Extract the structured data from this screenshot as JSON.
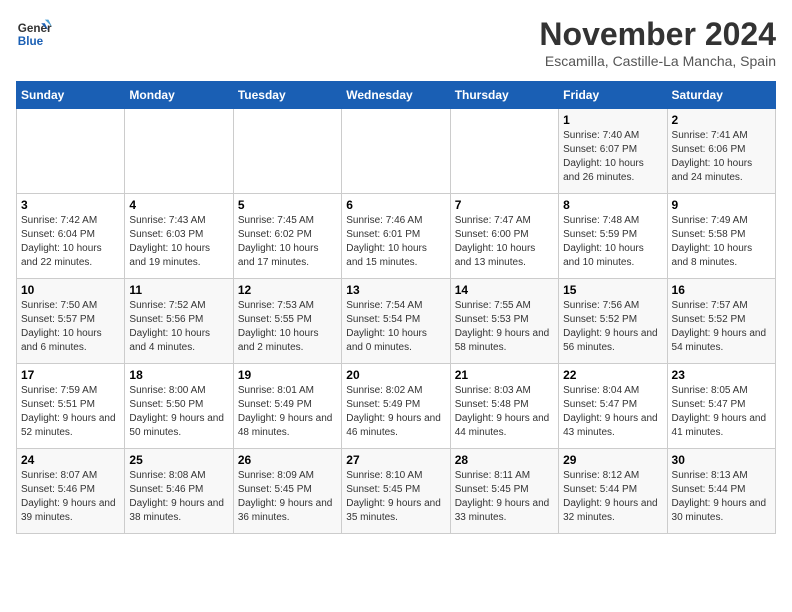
{
  "logo": {
    "line1": "General",
    "line2": "Blue"
  },
  "title": "November 2024",
  "location": "Escamilla, Castille-La Mancha, Spain",
  "days_of_week": [
    "Sunday",
    "Monday",
    "Tuesday",
    "Wednesday",
    "Thursday",
    "Friday",
    "Saturday"
  ],
  "weeks": [
    [
      {
        "day": "",
        "info": ""
      },
      {
        "day": "",
        "info": ""
      },
      {
        "day": "",
        "info": ""
      },
      {
        "day": "",
        "info": ""
      },
      {
        "day": "",
        "info": ""
      },
      {
        "day": "1",
        "info": "Sunrise: 7:40 AM\nSunset: 6:07 PM\nDaylight: 10 hours and 26 minutes."
      },
      {
        "day": "2",
        "info": "Sunrise: 7:41 AM\nSunset: 6:06 PM\nDaylight: 10 hours and 24 minutes."
      }
    ],
    [
      {
        "day": "3",
        "info": "Sunrise: 7:42 AM\nSunset: 6:04 PM\nDaylight: 10 hours and 22 minutes."
      },
      {
        "day": "4",
        "info": "Sunrise: 7:43 AM\nSunset: 6:03 PM\nDaylight: 10 hours and 19 minutes."
      },
      {
        "day": "5",
        "info": "Sunrise: 7:45 AM\nSunset: 6:02 PM\nDaylight: 10 hours and 17 minutes."
      },
      {
        "day": "6",
        "info": "Sunrise: 7:46 AM\nSunset: 6:01 PM\nDaylight: 10 hours and 15 minutes."
      },
      {
        "day": "7",
        "info": "Sunrise: 7:47 AM\nSunset: 6:00 PM\nDaylight: 10 hours and 13 minutes."
      },
      {
        "day": "8",
        "info": "Sunrise: 7:48 AM\nSunset: 5:59 PM\nDaylight: 10 hours and 10 minutes."
      },
      {
        "day": "9",
        "info": "Sunrise: 7:49 AM\nSunset: 5:58 PM\nDaylight: 10 hours and 8 minutes."
      }
    ],
    [
      {
        "day": "10",
        "info": "Sunrise: 7:50 AM\nSunset: 5:57 PM\nDaylight: 10 hours and 6 minutes."
      },
      {
        "day": "11",
        "info": "Sunrise: 7:52 AM\nSunset: 5:56 PM\nDaylight: 10 hours and 4 minutes."
      },
      {
        "day": "12",
        "info": "Sunrise: 7:53 AM\nSunset: 5:55 PM\nDaylight: 10 hours and 2 minutes."
      },
      {
        "day": "13",
        "info": "Sunrise: 7:54 AM\nSunset: 5:54 PM\nDaylight: 10 hours and 0 minutes."
      },
      {
        "day": "14",
        "info": "Sunrise: 7:55 AM\nSunset: 5:53 PM\nDaylight: 9 hours and 58 minutes."
      },
      {
        "day": "15",
        "info": "Sunrise: 7:56 AM\nSunset: 5:52 PM\nDaylight: 9 hours and 56 minutes."
      },
      {
        "day": "16",
        "info": "Sunrise: 7:57 AM\nSunset: 5:52 PM\nDaylight: 9 hours and 54 minutes."
      }
    ],
    [
      {
        "day": "17",
        "info": "Sunrise: 7:59 AM\nSunset: 5:51 PM\nDaylight: 9 hours and 52 minutes."
      },
      {
        "day": "18",
        "info": "Sunrise: 8:00 AM\nSunset: 5:50 PM\nDaylight: 9 hours and 50 minutes."
      },
      {
        "day": "19",
        "info": "Sunrise: 8:01 AM\nSunset: 5:49 PM\nDaylight: 9 hours and 48 minutes."
      },
      {
        "day": "20",
        "info": "Sunrise: 8:02 AM\nSunset: 5:49 PM\nDaylight: 9 hours and 46 minutes."
      },
      {
        "day": "21",
        "info": "Sunrise: 8:03 AM\nSunset: 5:48 PM\nDaylight: 9 hours and 44 minutes."
      },
      {
        "day": "22",
        "info": "Sunrise: 8:04 AM\nSunset: 5:47 PM\nDaylight: 9 hours and 43 minutes."
      },
      {
        "day": "23",
        "info": "Sunrise: 8:05 AM\nSunset: 5:47 PM\nDaylight: 9 hours and 41 minutes."
      }
    ],
    [
      {
        "day": "24",
        "info": "Sunrise: 8:07 AM\nSunset: 5:46 PM\nDaylight: 9 hours and 39 minutes."
      },
      {
        "day": "25",
        "info": "Sunrise: 8:08 AM\nSunset: 5:46 PM\nDaylight: 9 hours and 38 minutes."
      },
      {
        "day": "26",
        "info": "Sunrise: 8:09 AM\nSunset: 5:45 PM\nDaylight: 9 hours and 36 minutes."
      },
      {
        "day": "27",
        "info": "Sunrise: 8:10 AM\nSunset: 5:45 PM\nDaylight: 9 hours and 35 minutes."
      },
      {
        "day": "28",
        "info": "Sunrise: 8:11 AM\nSunset: 5:45 PM\nDaylight: 9 hours and 33 minutes."
      },
      {
        "day": "29",
        "info": "Sunrise: 8:12 AM\nSunset: 5:44 PM\nDaylight: 9 hours and 32 minutes."
      },
      {
        "day": "30",
        "info": "Sunrise: 8:13 AM\nSunset: 5:44 PM\nDaylight: 9 hours and 30 minutes."
      }
    ]
  ]
}
